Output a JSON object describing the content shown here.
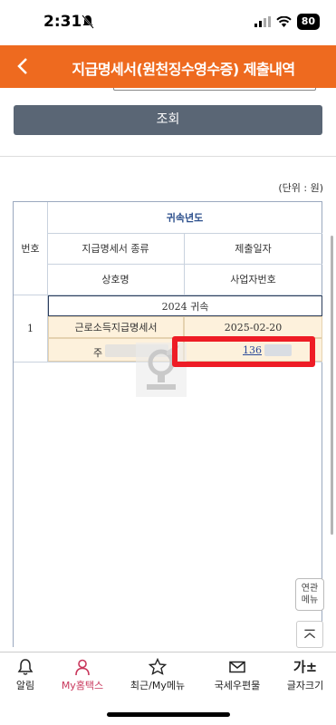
{
  "status_bar": {
    "time": "2:31",
    "battery": "80"
  },
  "header": {
    "title": "지급명세서(원천징수영수증) 제출내역"
  },
  "search_button": {
    "label": "조회"
  },
  "unit_label": "(단위 : 원)",
  "table": {
    "headers": {
      "number": "번호",
      "year": "귀속년도",
      "kind": "지급명세서 종류",
      "submit_date": "제출일자",
      "company_name": "상호명",
      "business_number": "사업자번호"
    },
    "rows": [
      {
        "number": "1",
        "year": "2024 귀속",
        "kind": "근로소득지급명세서",
        "submit_date": "2025-02-20",
        "company_name": "주",
        "business_number": "136"
      }
    ]
  },
  "related_menu": {
    "line1": "연관",
    "line2": "메뉴"
  },
  "bottom_nav": {
    "items": [
      {
        "label": "알림",
        "icon": "bell-icon"
      },
      {
        "label": "My홈택스",
        "icon": "person-icon",
        "active": true
      },
      {
        "label": "최근/My메뉴",
        "icon": "star-icon"
      },
      {
        "label": "국세우편물",
        "icon": "envelope-icon"
      },
      {
        "label": "글자크기",
        "icon": "font-size-icon",
        "glyph": "가±"
      }
    ]
  },
  "colors": {
    "header": "#ee6a1f",
    "search_button": "#5a6675",
    "highlight": "#ee1c25",
    "active_nav": "#c8365b",
    "row_bg": "#fdf1dc"
  }
}
